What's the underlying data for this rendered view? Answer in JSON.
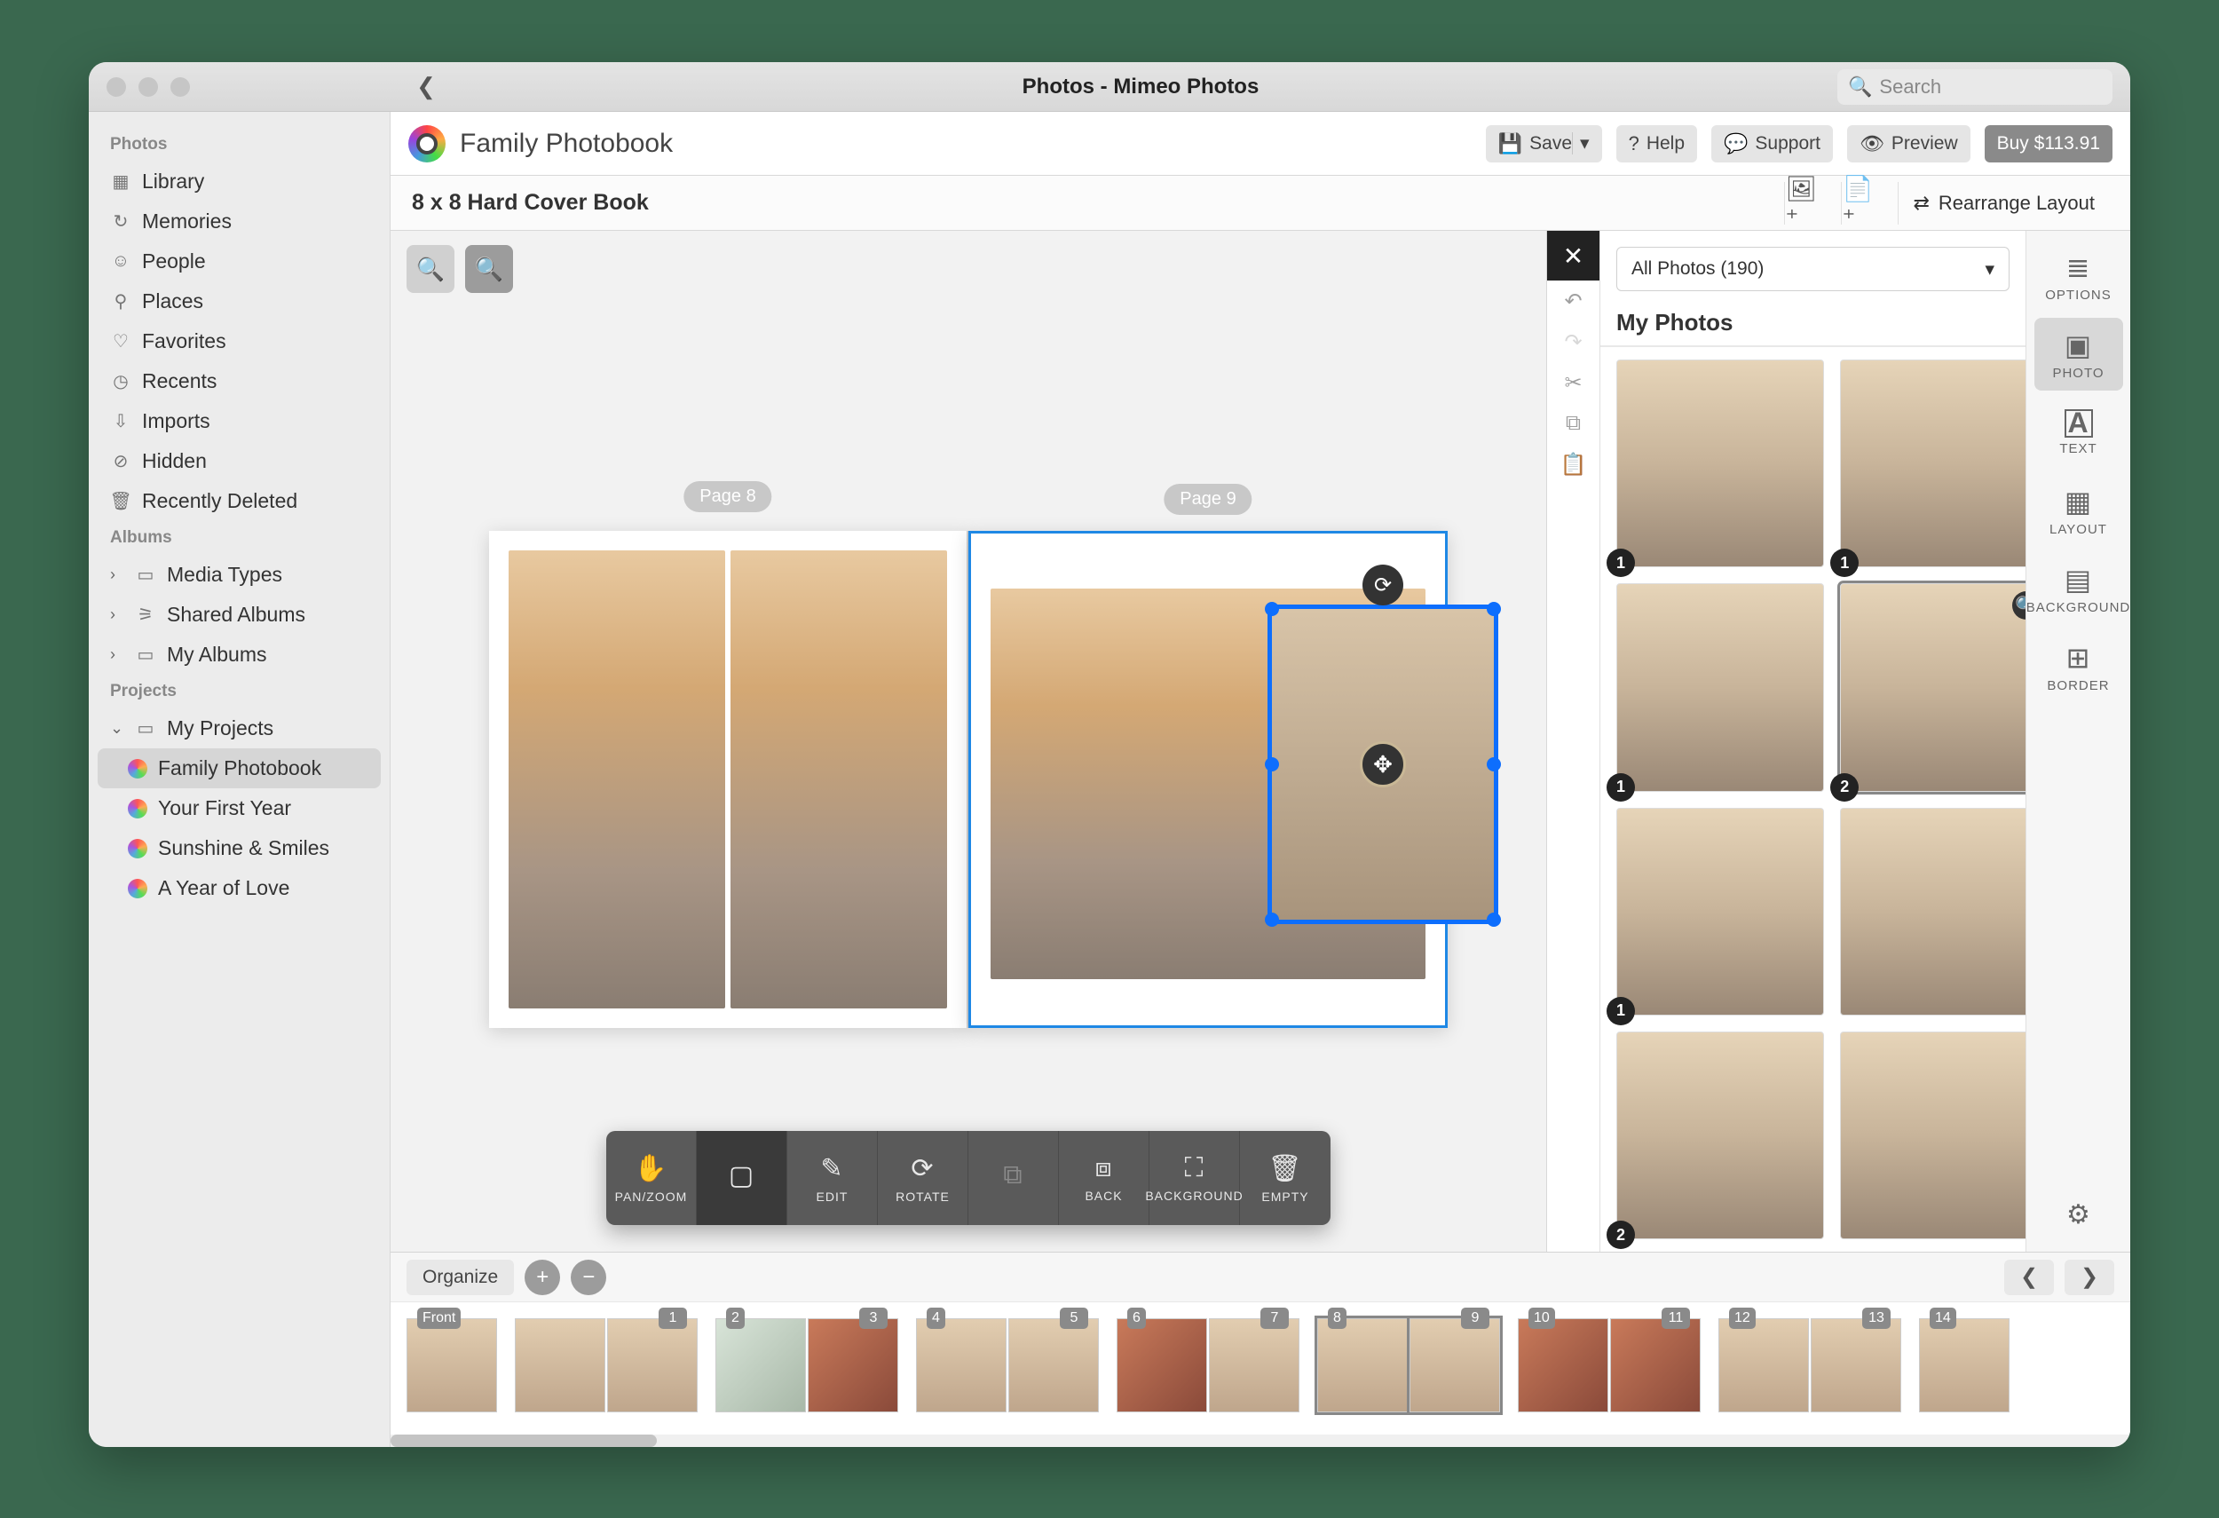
{
  "titlebar": {
    "title": "Photos - Mimeo Photos",
    "search_placeholder": "Search"
  },
  "sidebar": {
    "sections": [
      {
        "heading": "Photos",
        "items": [
          {
            "label": "Library",
            "icon": "grid"
          },
          {
            "label": "Memories",
            "icon": "clock"
          },
          {
            "label": "People",
            "icon": "person"
          },
          {
            "label": "Places",
            "icon": "pin"
          },
          {
            "label": "Favorites",
            "icon": "heart"
          },
          {
            "label": "Recents",
            "icon": "recent"
          },
          {
            "label": "Imports",
            "icon": "download"
          },
          {
            "label": "Hidden",
            "icon": "eye-off"
          },
          {
            "label": "Recently Deleted",
            "icon": "trash"
          }
        ]
      },
      {
        "heading": "Albums",
        "items": [
          {
            "label": "Media Types",
            "chevron": true
          },
          {
            "label": "Shared Albums",
            "chevron": true
          },
          {
            "label": "My Albums",
            "chevron": true
          }
        ]
      },
      {
        "heading": "Projects",
        "items": [
          {
            "label": "My Projects",
            "chevron_down": true
          }
        ],
        "children": [
          {
            "label": "Family Photobook",
            "active": true
          },
          {
            "label": "Your First Year"
          },
          {
            "label": "Sunshine & Smiles"
          },
          {
            "label": "A Year of Love"
          }
        ]
      }
    ]
  },
  "app_toolbar": {
    "project_name": "Family Photobook",
    "save": "Save",
    "help": "Help",
    "support": "Support",
    "preview": "Preview",
    "buy": "Buy $113.91"
  },
  "sub_toolbar": {
    "book_type": "8 x 8 Hard Cover Book",
    "rearrange": "Rearrange Layout"
  },
  "canvas": {
    "left_label": "Page 8",
    "right_label": "Page 9"
  },
  "context_toolbar": {
    "items": [
      {
        "label": "PAN/ZOOM",
        "icon": "✋"
      },
      {
        "label": "",
        "icon": "▢"
      },
      {
        "label": "EDIT",
        "icon": "✎"
      },
      {
        "label": "ROTATE",
        "icon": "⟳"
      },
      {
        "label": "",
        "icon": "⧉",
        "dim": true
      },
      {
        "label": "BACK",
        "icon": "⧈"
      },
      {
        "label": "BACKGROUND",
        "icon": "⛶"
      },
      {
        "label": "EMPTY",
        "icon": "🗑"
      }
    ]
  },
  "photo_panel": {
    "filter": "All Photos (190)",
    "title": "My Photos",
    "thumbs": [
      {
        "count": "1"
      },
      {
        "count": "1"
      },
      {
        "count": "1"
      },
      {
        "count": "2",
        "selected": true,
        "zoom": true
      },
      {
        "count": "1"
      },
      {
        "count": ""
      },
      {
        "count": "2"
      },
      {
        "count": ""
      }
    ]
  },
  "right_tools": {
    "items": [
      {
        "label": "OPTIONS",
        "icon": "⚙"
      },
      {
        "label": "PHOTO",
        "icon": "▣",
        "active": true
      },
      {
        "label": "TEXT",
        "icon": "A"
      },
      {
        "label": "LAYOUT",
        "icon": "▦"
      },
      {
        "label": "BACKGROUND",
        "icon": "▤"
      },
      {
        "label": "BORDER",
        "icon": "▢"
      }
    ]
  },
  "filmstrip_bar": {
    "organize": "Organize"
  },
  "filmstrip": {
    "pages": [
      {
        "left": "Front",
        "single": true
      },
      {
        "left": "",
        "right": "1"
      },
      {
        "left": "2",
        "right": "3"
      },
      {
        "left": "4",
        "right": "5"
      },
      {
        "left": "6",
        "right": "7"
      },
      {
        "left": "8",
        "right": "9",
        "active": true
      },
      {
        "left": "10",
        "right": "11"
      },
      {
        "left": "12",
        "right": "13"
      },
      {
        "left": "14",
        "right": ""
      }
    ]
  }
}
